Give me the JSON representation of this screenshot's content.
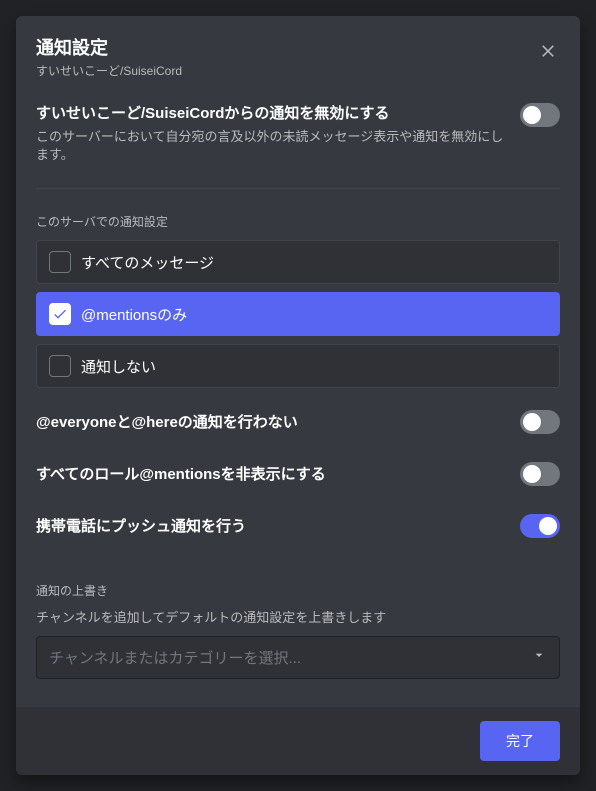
{
  "header": {
    "title": "通知設定",
    "subtitle": "すいせいこーど/SuiseiCord"
  },
  "mute": {
    "title": "すいせいこーど/SuiseiCordからの通知を無効にする",
    "desc": "このサーバーにおいて自分宛の言及以外の未読メッセージ表示や通知を無効にします。",
    "enabled": false
  },
  "server_notif": {
    "section_label": "このサーバでの通知設定",
    "options": [
      {
        "label": "すべてのメッセージ",
        "selected": false
      },
      {
        "label": "@mentionsのみ",
        "selected": true
      },
      {
        "label": "通知しない",
        "selected": false
      }
    ]
  },
  "toggles": {
    "suppress_everyone": {
      "label": "@everyoneと@hereの通知を行わない",
      "enabled": false
    },
    "suppress_roles": {
      "label": "すべてのロール@mentionsを非表示にする",
      "enabled": false
    },
    "mobile_push": {
      "label": "携帯電話にプッシュ通知を行う",
      "enabled": true
    }
  },
  "overrides": {
    "section_label": "通知の上書き",
    "desc": "チャンネルを追加してデフォルトの通知設定を上書きします",
    "select_placeholder": "チャンネルまたはカテゴリーを選択..."
  },
  "footer": {
    "done_label": "完了"
  }
}
